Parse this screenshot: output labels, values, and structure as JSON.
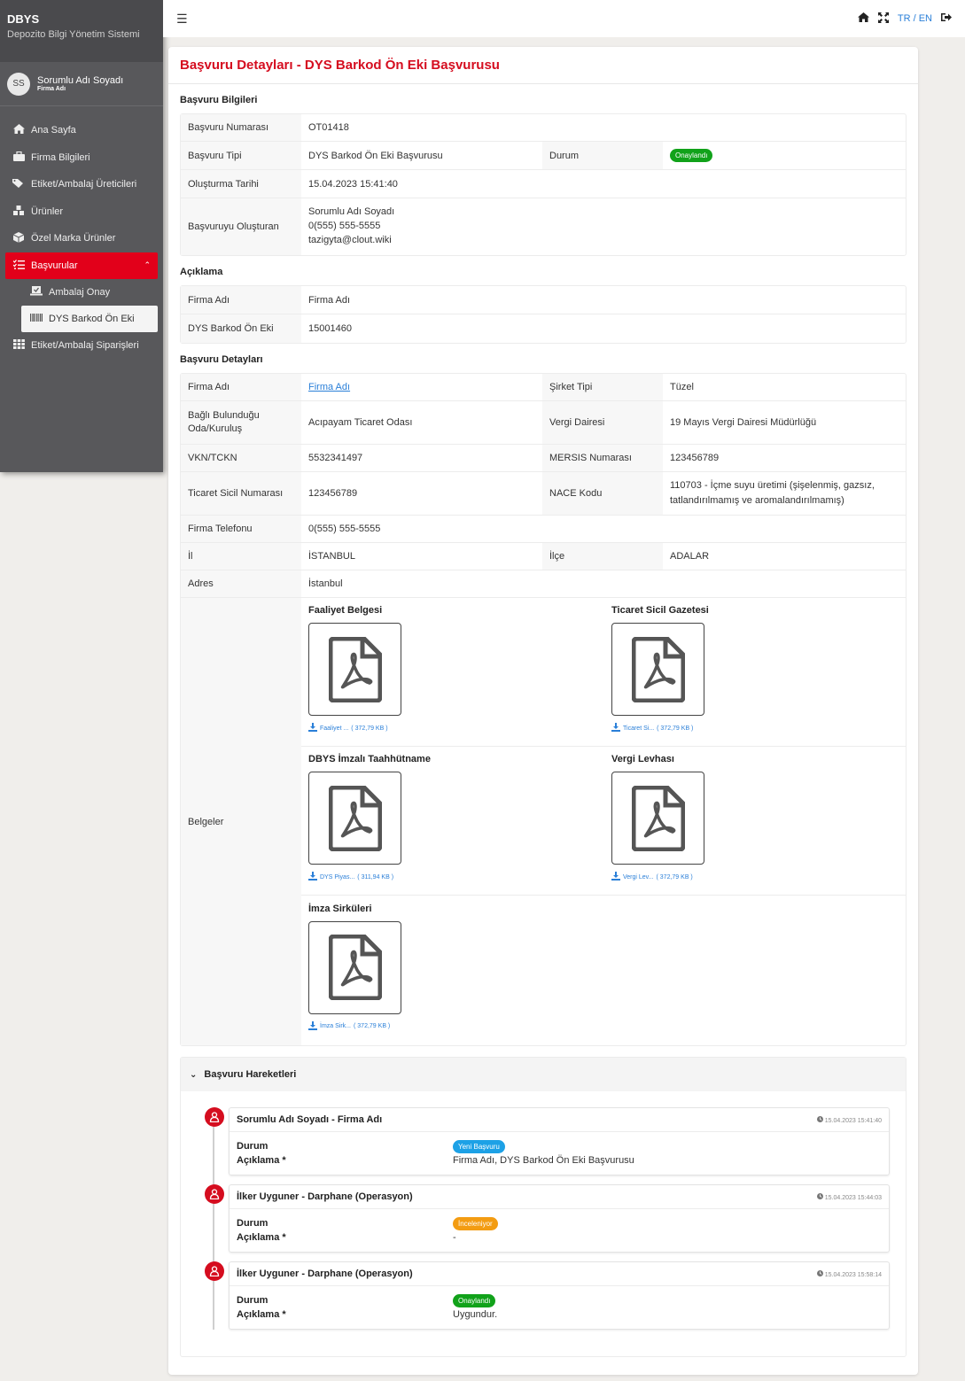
{
  "app": {
    "brand": "DBYS",
    "subtitle": "Depozito Bilgi Yönetim Sistemi"
  },
  "user": {
    "initials": "SS",
    "name": "Sorumlu Adı Soyadı",
    "firm": "Firma Adı"
  },
  "nav": {
    "home": "Ana Sayfa",
    "firm": "Firma Bilgileri",
    "producers": "Etiket/Ambalaj Üreticileri",
    "products": "Ürünler",
    "private_products": "Özel Marka Ürünler",
    "applications": "Başvurular",
    "sub_packaging": "Ambalaj Onay",
    "sub_barcode": "DYS Barkod Ön Eki",
    "orders": "Etiket/Ambalaj Siparişleri"
  },
  "topbar": {
    "tr": "TR",
    "sep": "/",
    "en": "EN"
  },
  "page": {
    "title": "Başvuru Detayları - DYS Barkod Ön Eki Başvurusu"
  },
  "application_info": {
    "heading": "Başvuru Bilgileri",
    "number_label": "Başvuru Numarası",
    "number": "OT01418",
    "type_label": "Başvuru Tipi",
    "type": "DYS Barkod Ön Eki Başvurusu",
    "status_label": "Durum",
    "status": "Onaylandı",
    "created_label": "Oluşturma Tarihi",
    "created": "15.04.2023 15:41:40",
    "creator_label": "Başvuruyu Oluşturan",
    "creator_name": "Sorumlu Adı Soyadı",
    "creator_phone": "0(555) 555-5555",
    "creator_email": "tazigyta@clout.wiki"
  },
  "description": {
    "heading": "Açıklama",
    "firm_label": "Firma Adı",
    "firm": "Firma Adı",
    "prefix_label": "DYS Barkod Ön Eki",
    "prefix": "15001460"
  },
  "details": {
    "heading": "Başvuru Detayları",
    "firm_label": "Firma Adı",
    "firm": "Firma Adı",
    "company_type_label": "Şirket Tipi",
    "company_type": "Tüzel",
    "chamber_label": "Bağlı Bulunduğu Oda/Kuruluş",
    "chamber": "Acıpayam Ticaret Odası",
    "tax_office_label": "Vergi Dairesi",
    "tax_office": "19 Mayıs Vergi Dairesi Müdürlüğü",
    "vkn_label": "VKN/TCKN",
    "vkn": "5532341497",
    "mersis_label": "MERSIS Numarası",
    "mersis": "123456789",
    "trade_reg_label": "Ticaret Sicil Numarası",
    "trade_reg": "123456789",
    "nace_label": "NACE Kodu",
    "nace_code": "110703",
    "nace_desc": " - İçme suyu üretimi (şişelenmiş, gazsız, tatlandırılmamış ve aromalandırılmamış)",
    "phone_label": "Firma Telefonu",
    "phone": "0(555) 555-5555",
    "city_label": "İl",
    "city": "İSTANBUL",
    "district_label": "İlçe",
    "district": "ADALAR",
    "address_label": "Adres",
    "address": "İstanbul",
    "docs_label": "Belgeler"
  },
  "documents": [
    {
      "title": "Faaliyet Belgesi",
      "file": "Faaliyet ...",
      "size": "( 372,79 KB )"
    },
    {
      "title": "Ticaret Sicil Gazetesi",
      "file": "Ticaret Si...",
      "size": "( 372,79 KB )"
    },
    {
      "title": "DBYS İmzalı Taahhütname",
      "file": "DYS Piyas...",
      "size": "( 311,94 KB )"
    },
    {
      "title": "Vergi Levhası",
      "file": "Vergi Lev...",
      "size": "( 372,79 KB )"
    },
    {
      "title": "İmza Sirküleri",
      "file": "İmza Sirk...",
      "size": "( 372,79 KB )"
    }
  ],
  "movements": {
    "heading": "Başvuru Hareketleri",
    "status_label": "Durum",
    "desc_label": "Açıklama *",
    "items": [
      {
        "user": "Sorumlu Adı Soyadı - Firma Adı",
        "time": "15.04.2023 15:41:40",
        "status": "Yeni Başvuru",
        "status_color": "#1da1e6",
        "desc": "Firma Adı, DYS Barkod Ön Eki Başvurusu"
      },
      {
        "user": "İlker Uyguner - Darphane (Operasyon)",
        "time": "15.04.2023 15:44:03",
        "status": "İnceleniyor",
        "status_color": "#f39c12",
        "desc": "-"
      },
      {
        "user": "İlker Uyguner - Darphane (Operasyon)",
        "time": "15.04.2023 15:58:14",
        "status": "Onaylandı",
        "status_color": "#11a21a",
        "desc": "Uygundur."
      }
    ]
  },
  "colors": {
    "accent": "#d50d1f",
    "sidebar": "#58585b",
    "link": "#2a7fd8",
    "approved": "#11a21a"
  }
}
